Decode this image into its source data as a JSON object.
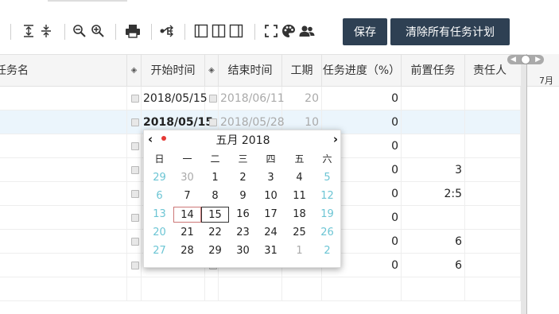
{
  "toolbar": {
    "save_label": "保存",
    "clear_label": "清除所有任务计划"
  },
  "grid": {
    "headers": {
      "task_name": "任务名",
      "start": "开始时间",
      "end": "结束时间",
      "duration": "工期",
      "progress": "任务进度（%）",
      "predecessor": "前置任务",
      "owner": "责任人"
    },
    "gantt_month": "7月",
    "rows": [
      {
        "start": "2018/05/15",
        "end": "2018/06/11",
        "duration": "20",
        "progress": "0",
        "pred": ""
      },
      {
        "start": "2018/05/15",
        "end": "2018/05/28",
        "duration": "10",
        "progress": "0",
        "pred": ""
      },
      {
        "start": "",
        "end": "",
        "duration": "",
        "progress": "0",
        "pred": ""
      },
      {
        "start": "",
        "end": "",
        "duration": "",
        "progress": "0",
        "pred": "3"
      },
      {
        "start": "",
        "end": "",
        "duration": "",
        "progress": "0",
        "pred": "2:5"
      },
      {
        "start": "",
        "end": "",
        "duration": "",
        "progress": "0",
        "pred": ""
      },
      {
        "start": "",
        "end": "",
        "duration": "",
        "progress": "0",
        "pred": "6"
      },
      {
        "start": "",
        "end": "",
        "duration": "",
        "progress": "0",
        "pred": "6"
      }
    ]
  },
  "calendar": {
    "title": "五月 2018",
    "weekdays": [
      "日",
      "一",
      "二",
      "三",
      "四",
      "五",
      "六"
    ],
    "weeks": [
      [
        "29",
        "30",
        "1",
        "2",
        "3",
        "4",
        "5"
      ],
      [
        "6",
        "7",
        "8",
        "9",
        "10",
        "11",
        "12"
      ],
      [
        "13",
        "14",
        "15",
        "16",
        "17",
        "18",
        "19"
      ],
      [
        "20",
        "21",
        "22",
        "23",
        "24",
        "25",
        "26"
      ],
      [
        "27",
        "28",
        "29",
        "30",
        "31",
        "1",
        "2"
      ]
    ],
    "today": "14",
    "selected": "15"
  }
}
